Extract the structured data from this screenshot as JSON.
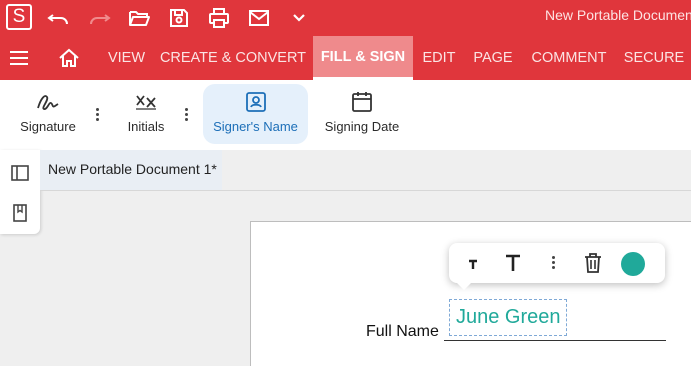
{
  "app": {
    "logo_letter": "S",
    "document_title": "New Portable Document 1"
  },
  "quick_access": [
    {
      "name": "undo-icon"
    },
    {
      "name": "redo-icon"
    },
    {
      "name": "open-folder-icon"
    },
    {
      "name": "save-icon"
    },
    {
      "name": "print-icon"
    },
    {
      "name": "mail-icon"
    },
    {
      "name": "chevron-down-icon"
    }
  ],
  "nav": {
    "tabs": [
      {
        "label": "VIEW"
      },
      {
        "label": "CREATE & CONVERT"
      },
      {
        "label": "FILL & SIGN"
      },
      {
        "label": "EDIT"
      },
      {
        "label": "PAGE"
      },
      {
        "label": "COMMENT"
      },
      {
        "label": "SECURE"
      }
    ],
    "active_tab": "FILL & SIGN"
  },
  "ribbon": {
    "signature": "Signature",
    "initials": "Initials",
    "signers_name": "Signer's Name",
    "signing_date": "Signing Date"
  },
  "doc_tab": {
    "label": "New Portable Document 1*"
  },
  "form": {
    "field_label": "Full Name",
    "signer_value": "June Green",
    "signer_color": "#20a99a"
  },
  "colors": {
    "brand": "#e0363c",
    "active_tab": "#ef8a8c",
    "ribbon_active": "#e5f0fb",
    "ribbon_active_text": "#1d6fb8"
  }
}
